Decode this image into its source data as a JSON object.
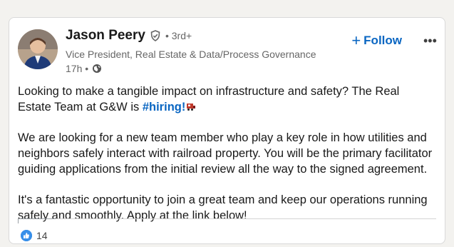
{
  "author": {
    "name": "Jason Peery",
    "degree": "• 3rd+",
    "headline": "Vice President, Real Estate & Data/Process Governance",
    "time": "17h •",
    "avatar_icon": "profile-photo"
  },
  "actions": {
    "follow_label": "Follow",
    "follow_icon": "+",
    "more_label": "•••"
  },
  "post": {
    "p1_text": "Looking to make a tangible impact on infrastructure and safety? The Real Estate Team at G&W is ",
    "p1_hashtag": "#hiring!",
    "p2": "We are looking for a new team member who play a key role in how utilities and neighbors safely interact with railroad property. You will be the primary facilitator guiding applications from the initial review all the way to the signed agreement.",
    "p3": "It's a fantastic opportunity to join a great team and keep our operations running safely and smoothly. Apply at the link below!"
  },
  "social": {
    "reaction_count": "14",
    "reaction_icon": "like-icon"
  },
  "colors": {
    "link": "#0a66c2",
    "text": "#191919",
    "muted": "#666666"
  }
}
